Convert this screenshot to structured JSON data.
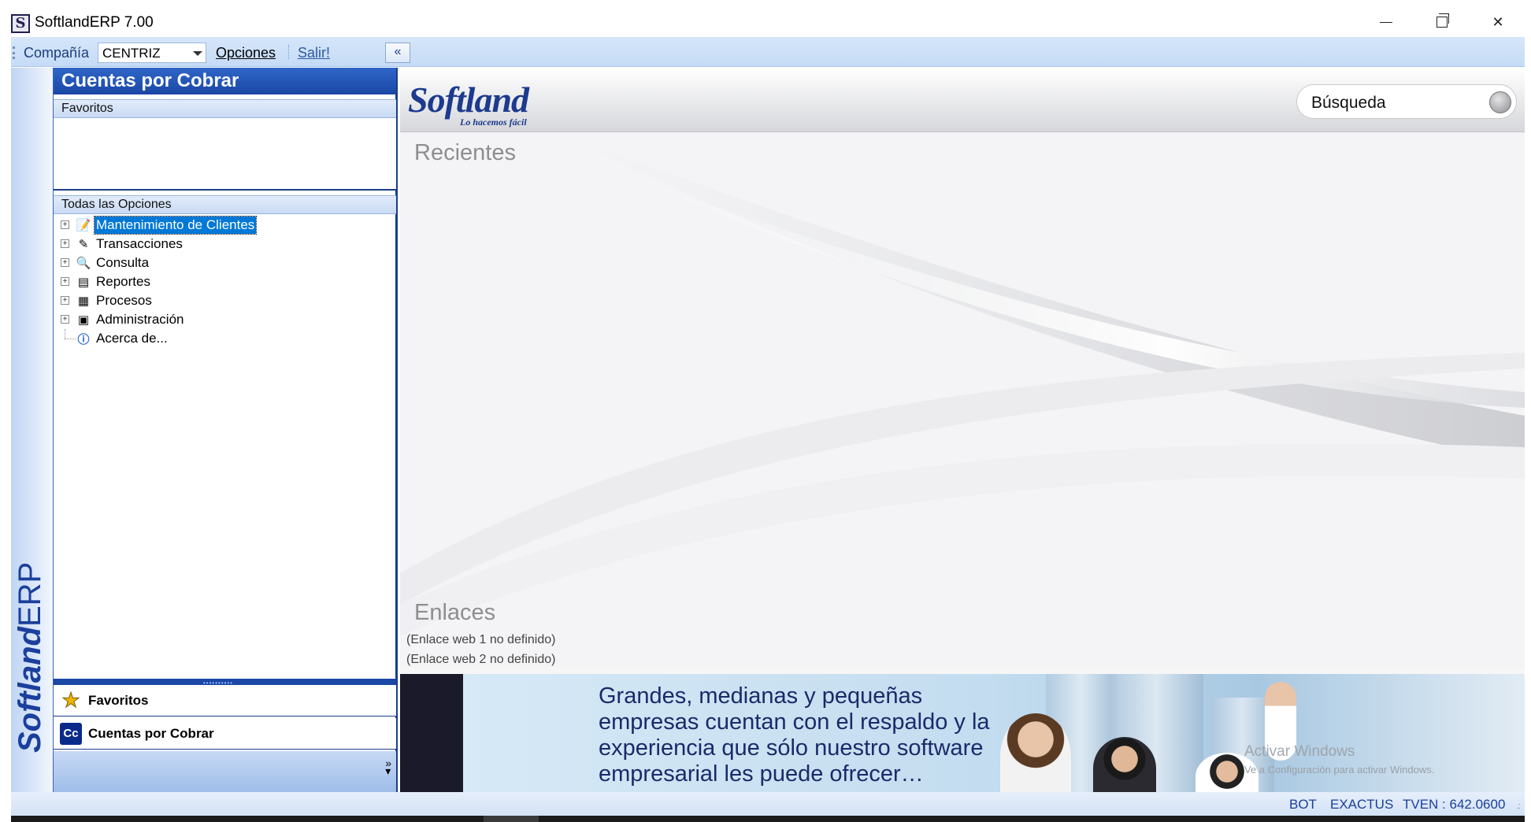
{
  "window": {
    "title": "SoftlandERP 7.00",
    "app_icon_letter": "S"
  },
  "menubar": {
    "company_label": "Compañía",
    "company_value": "CENTRIZ",
    "options_label": "Opciones",
    "exit_label": "Salir!",
    "collapse_symbol": "«"
  },
  "brand": {
    "bold": "Softland",
    "light": "ERP"
  },
  "nav": {
    "header": "Cuentas por Cobrar",
    "favorites_section": "Favoritos",
    "all_options_section": "Todas las Opciones",
    "tree": [
      {
        "label": "Mantenimiento de Clientes",
        "icon": "maintenance-icon",
        "expandable": true,
        "selected": true
      },
      {
        "label": "Transacciones",
        "icon": "transactions-icon",
        "expandable": true,
        "selected": false
      },
      {
        "label": "Consulta",
        "icon": "query-icon",
        "expandable": true,
        "selected": false
      },
      {
        "label": "Reportes",
        "icon": "reports-icon",
        "expandable": true,
        "selected": false
      },
      {
        "label": "Procesos",
        "icon": "processes-icon",
        "expandable": true,
        "selected": false
      },
      {
        "label": "Administración",
        "icon": "administration-icon",
        "expandable": true,
        "selected": false
      },
      {
        "label": "Acerca de...",
        "icon": "info-icon",
        "expandable": false,
        "selected": false
      }
    ],
    "buttons": {
      "favorites": "Favoritos",
      "module": "Cuentas por Cobrar",
      "module_icon_text": "Cc"
    }
  },
  "main": {
    "logo_main": "Softland",
    "logo_sub": "Lo hacemos fácil",
    "search_placeholder": "Búsqueda",
    "recent_title": "Recientes",
    "links_title": "Enlaces",
    "links": [
      "(Enlace web 1 no definido)",
      "(Enlace web 2 no definido)"
    ],
    "banner_text": "Grandes, medianas y pequeñas empresas cuentan con el respaldo y la experiencia que sólo nuestro software empresarial les puede ofrecer…",
    "activation_title": "Activar Windows",
    "activation_sub": "Ve a Configuración para activar Windows."
  },
  "statusbar": {
    "items": [
      "BOT",
      "EXACTUS",
      "TVEN : 642.0600"
    ]
  },
  "colors": {
    "accent_blue": "#1a47a6",
    "menubar_bg": "#c5dbf6",
    "selection": "#0078d7"
  }
}
